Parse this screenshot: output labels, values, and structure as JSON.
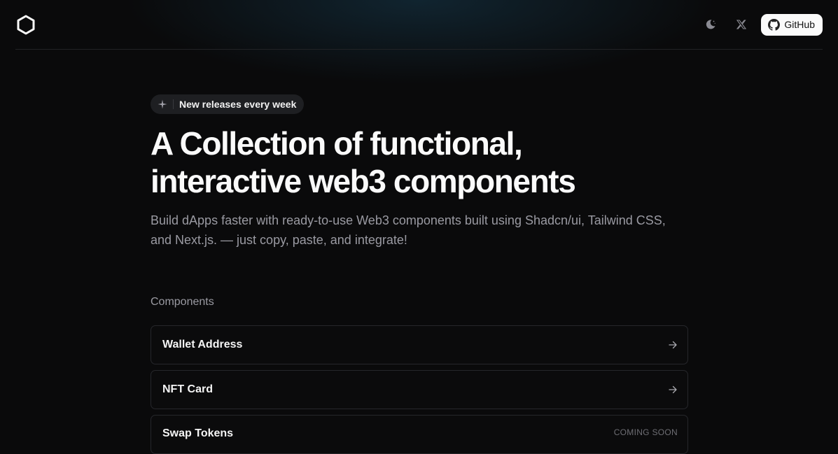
{
  "header": {
    "logo_icon": "hexagon-logo-icon",
    "theme_icon": "moon-icon",
    "x_icon": "x-twitter-icon",
    "github_label": "GitHub",
    "github_icon": "github-icon"
  },
  "hero": {
    "badge_icon": "sparkle-icon",
    "badge_text": "New releases every week",
    "title_line1": "A Collection of functional,",
    "title_line2": "interactive web3 components",
    "subtitle": "Build dApps faster with ready-to-use Web3 components built using Shadcn/ui, Tailwind CSS, and Next.js. — just copy, paste, and integrate!"
  },
  "components": {
    "label": "Components",
    "items": [
      {
        "title": "Wallet Address",
        "status": "",
        "icon": "arrow-right-icon"
      },
      {
        "title": "NFT Card",
        "status": "",
        "icon": "arrow-right-icon"
      },
      {
        "title": "Swap Tokens",
        "status": "COMING SOON",
        "icon": ""
      }
    ]
  },
  "colors": {
    "background": "#0a0a0b",
    "text": "#fafafa",
    "muted": "#9a9aa2",
    "border": "#26272b"
  }
}
